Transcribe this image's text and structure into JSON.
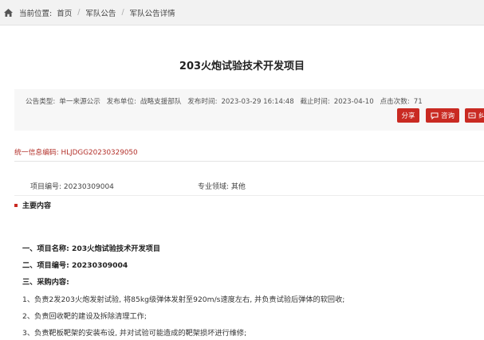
{
  "breadcrumb": {
    "prefix": "当前位置:",
    "items": [
      "首页",
      "军队公告",
      "军队公告详情"
    ],
    "separator": "/"
  },
  "title": "203火炮试验技术开发项目",
  "meta": {
    "type_label": "公告类型:",
    "type_value": "单一来源公示",
    "unit_label": "发布单位:",
    "unit_value": "战略支援部队",
    "time_label": "发布时间:",
    "time_value": "2023-03-29 16:14:48",
    "deadline_label": "截止时间:",
    "deadline_value": "2023-04-10",
    "clicks_label": "点击次数:",
    "clicks_value": "71"
  },
  "buttons": {
    "share": "分享",
    "consult": "咨询",
    "third": "纠"
  },
  "unified_code": "统一信息编码: HLJDGG20230329050",
  "info": {
    "project_no_label": "项目编号:",
    "project_no_value": "20230309004",
    "field_label": "专业领域:",
    "field_value": "其他"
  },
  "section_title": "主要内容",
  "content": {
    "line1": "一、项目名称: 203火炮试验技术开发项目",
    "line2": "二、项目编号: 20230309004",
    "line3": "三、采购内容:",
    "line4": "1、负责2发203火炮发射试验, 将85kg级弹体发射至920m/s速度左右, 并负责试验后弹体的软回收;",
    "line5": "2、负责回收靶的建设及拆除清理工作;",
    "line6": "3、负责靶板靶架的安装布设, 并对试验可能造成的靶架损坏进行维修;"
  },
  "colors": {
    "accent": "#c92a22",
    "code_text": "#b3302a"
  }
}
